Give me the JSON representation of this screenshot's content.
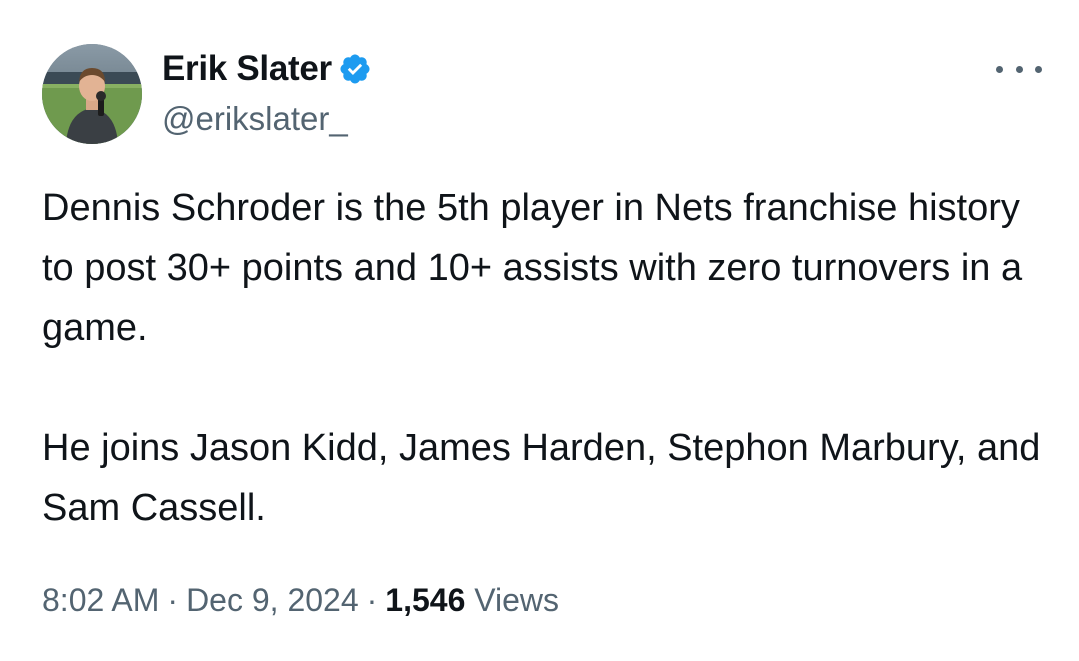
{
  "author": {
    "display_name": "Erik Slater",
    "handle": "@erikslater_",
    "verified": true,
    "verified_color": "#1d9bf0",
    "avatar_icon": "avatar-photo"
  },
  "more_menu": {
    "icon": "more-horizontal-icon"
  },
  "tweet": {
    "paragraphs": [
      "Dennis Schroder is the 5th player in Nets franchise history to post 30+ points and 10+ assists with zero turnovers in a game.",
      "He joins Jason Kidd, James Harden, Stephon Marbury, and Sam Cassell."
    ]
  },
  "meta": {
    "time": "8:02 AM",
    "separator": "·",
    "date": "Dec 9, 2024",
    "views_count": "1,546",
    "views_label": "Views"
  },
  "colors": {
    "text_primary": "#0f1419",
    "text_secondary": "#536471",
    "accent": "#1d9bf0"
  }
}
